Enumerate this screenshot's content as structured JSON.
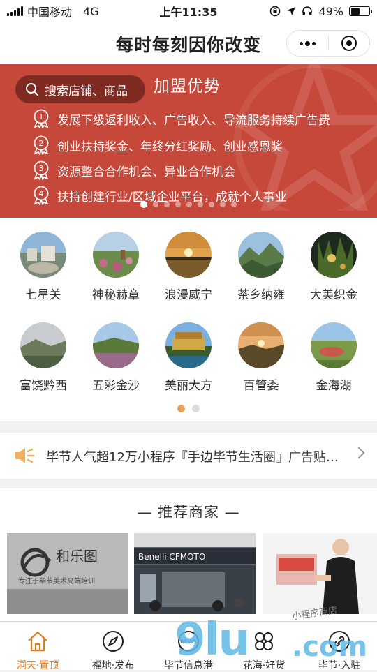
{
  "status_bar": {
    "carrier": "中国移动",
    "network": "4G",
    "time": "上午11:35",
    "battery": "49%",
    "battery_level": 0.49
  },
  "nav": {
    "title": "每时每刻因你改变"
  },
  "banner": {
    "search_placeholder": "搜索店铺、商品",
    "title": "加盟优势",
    "items": [
      {
        "num": "1",
        "text": "发展下级返利收入、广告收入、导流服务持续广告费"
      },
      {
        "num": "2",
        "text": "创业扶持奖金、年终分红奖励、创业感恩奖"
      },
      {
        "num": "3",
        "text": "资源整合合作机会、异业合作机会"
      },
      {
        "num": "4",
        "text": "扶持创建行业/区域企业平台，成就个人事业"
      }
    ],
    "active_slide": 0,
    "slide_count": 9
  },
  "places": [
    {
      "label": "七星关"
    },
    {
      "label": "神秘赫章"
    },
    {
      "label": "浪漫威宁"
    },
    {
      "label": "茶乡纳雍"
    },
    {
      "label": "大美织金"
    },
    {
      "label": "富饶黔西"
    },
    {
      "label": "五彩金沙"
    },
    {
      "label": "美丽大方"
    },
    {
      "label": "百管委"
    },
    {
      "label": "金海湖"
    }
  ],
  "places_page": {
    "active": 0,
    "count": 2
  },
  "notice": {
    "text": "毕节人气超12万小程序『手边毕节生活圈』广告贴…"
  },
  "recommend": {
    "title": "— 推荐商家 —",
    "merchants": [
      {
        "name": "和乐图",
        "tagline": "专注于毕节美术高端培训"
      },
      {
        "name": "Benelli CFMOTO"
      },
      {
        "name": "product-promo"
      }
    ]
  },
  "tabs": [
    {
      "label": "洞天·置顶",
      "icon": "home-icon",
      "active": true
    },
    {
      "label": "福地·发布",
      "icon": "compass-icon",
      "active": false
    },
    {
      "label": "毕节信息港",
      "icon": "news-icon",
      "active": false
    },
    {
      "label": "花海·好货",
      "icon": "clover-icon",
      "active": false
    },
    {
      "label": "毕节·入驻",
      "icon": "link-icon",
      "active": false
    }
  ],
  "watermark": {
    "brand": "9lu",
    "domain": ".com",
    "handwritten": "小程序商店"
  },
  "colors": {
    "banner_red": "#c6483a",
    "accent_orange": "#e07a1f",
    "watermark_blue": "#5fb8e6"
  }
}
